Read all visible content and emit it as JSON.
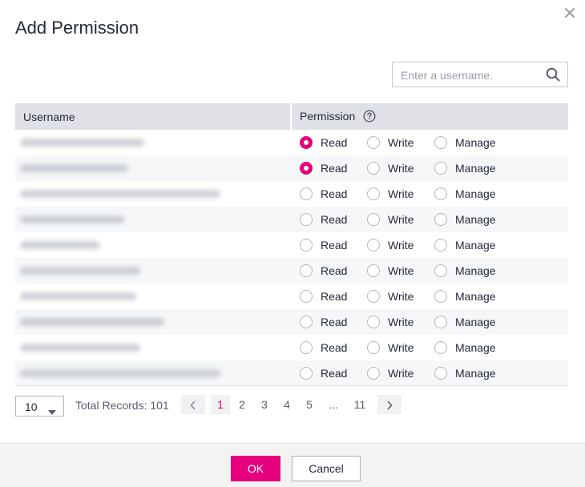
{
  "dialog": {
    "title": "Add Permission",
    "close_icon": "close-icon"
  },
  "search": {
    "placeholder": "Enter a username.",
    "value": "",
    "icon": "search-icon"
  },
  "table": {
    "headers": {
      "username": "Username",
      "permission": "Permission",
      "help_icon": "help-circle-icon"
    },
    "option_labels": {
      "read": "Read",
      "write": "Write",
      "manage": "Manage"
    },
    "rows": [
      {
        "username_obscured": true,
        "selected": "read"
      },
      {
        "username_obscured": true,
        "selected": "read"
      },
      {
        "username_obscured": true,
        "selected": ""
      },
      {
        "username_obscured": true,
        "selected": ""
      },
      {
        "username_obscured": true,
        "selected": ""
      },
      {
        "username_obscured": true,
        "selected": ""
      },
      {
        "username_obscured": true,
        "selected": ""
      },
      {
        "username_obscured": true,
        "selected": ""
      },
      {
        "username_obscured": true,
        "selected": ""
      },
      {
        "username_obscured": true,
        "selected": ""
      }
    ]
  },
  "pagination": {
    "page_size": "10",
    "total_label": "Total Records: 101",
    "pages": [
      "1",
      "2",
      "3",
      "4",
      "5",
      "...",
      "11"
    ],
    "current_page": "1",
    "prev_icon": "chevron-left-icon",
    "next_icon": "chevron-right-icon"
  },
  "footer": {
    "ok_label": "OK",
    "cancel_label": "Cancel"
  },
  "colors": {
    "accent": "#e6007d",
    "header_bg": "#dfe1e6",
    "row_alt_bg": "#f5f7f8",
    "footer_bg": "#f3f3f3"
  }
}
